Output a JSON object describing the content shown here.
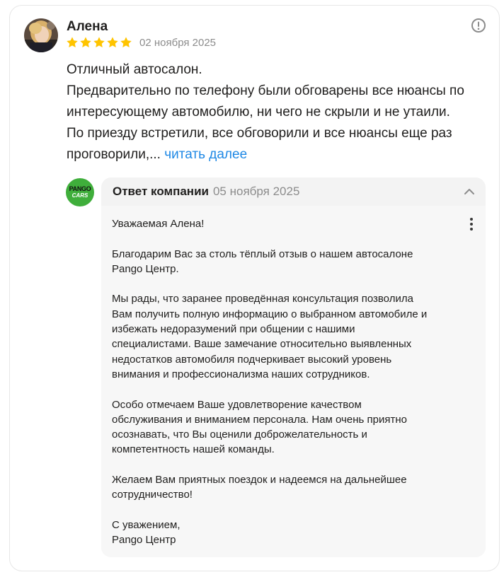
{
  "review": {
    "author": "Алена",
    "rating": 5,
    "date": "02 ноября 2025",
    "text_lines": [
      "Отличный автосалон.",
      "Предварительно по телефону были обговарены все нюансы по",
      "интересующему автомобилю, ни чего не скрыли и не утаили.",
      "По приезду встретили, все обговорили и все нюансы еще раз"
    ],
    "last_line": "проговорили,...",
    "read_more": "читать далее",
    "avatar_icon": "user-photo",
    "report_icon": "exclamation-circle-icon"
  },
  "reply": {
    "logo_top": "PANGO",
    "logo_bottom": "CARS",
    "title": "Ответ компании",
    "date": "05 ноября 2025",
    "collapse_icon": "chevron-up-icon",
    "more_icon": "vertical-dots-icon",
    "text_lines": [
      "Уважаемая Алена!",
      "",
      "Благодарим Вас за столь тёплый отзыв о нашем автосалоне",
      "Pango Центр.",
      "",
      "Мы рады, что заранее проведённая консультация позволила",
      "Вам получить полную информацию о выбранном автомобиле и",
      "избежать недоразумений при общении с нашими",
      "специалистами. Ваше замечание относительно выявленных",
      "недостатков автомобиля подчеркивает высокий уровень",
      "внимания и профессионализма наших сотрудников.",
      "",
      "Особо отмечаем Ваше удовлетворение качеством",
      "обслуживания и вниманием персонала. Нам очень приятно",
      "осознавать, что Вы оценили доброжелательность и",
      "компетентность нашей команды.",
      "",
      "Желаем Вам приятных поездок и надеемся на дальнейшее",
      "сотрудничество!",
      "",
      "С уважением,",
      "Pango Центр"
    ]
  },
  "colors": {
    "star": "#ffc400",
    "link": "#1e88e5",
    "logo_bg": "#3fae3b",
    "muted": "#8c8c8c"
  }
}
